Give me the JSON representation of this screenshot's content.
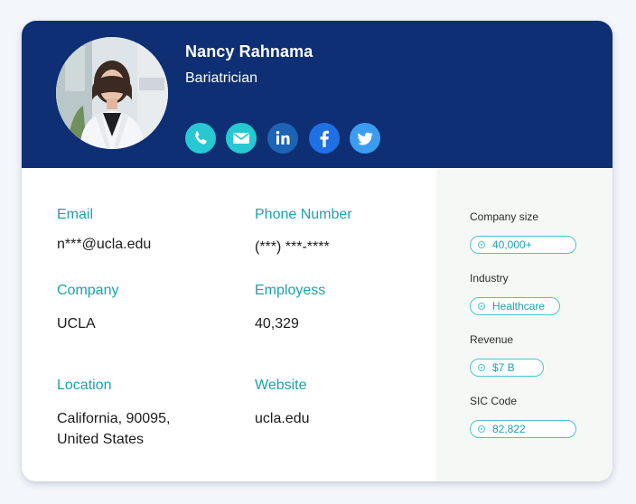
{
  "profile": {
    "name": "Nancy Rahnama",
    "title": "Bariatrician"
  },
  "social": [
    {
      "name": "phone-icon"
    },
    {
      "name": "mail-icon"
    },
    {
      "name": "linkedin-icon"
    },
    {
      "name": "facebook-icon"
    },
    {
      "name": "twitter-icon"
    }
  ],
  "details": {
    "email_label": "Email",
    "email_value": "n***@ucla.edu",
    "phone_label": "Phone Number",
    "phone_value": "(***) ***-****",
    "company_label": "Company",
    "company_value": "UCLA",
    "employees_label": "Employess",
    "employees_value": "40,329",
    "location_label": "Location",
    "location_line1": "California, 90095,",
    "location_line2": "United States",
    "website_label": "Website",
    "website_value": "ucla.edu"
  },
  "sidebar": {
    "company_size_label": "Company size",
    "company_size_value": "40,000+",
    "industry_label": "Industry",
    "industry_value": "Healthcare",
    "revenue_label": "Revenue",
    "revenue_value": "$7 B",
    "sic_label": "SIC Code",
    "sic_value": "82,822"
  },
  "colors": {
    "header": "#0e2f73",
    "accent": "#1aa3ac",
    "sidebar_bg": "#f6f8f5"
  }
}
